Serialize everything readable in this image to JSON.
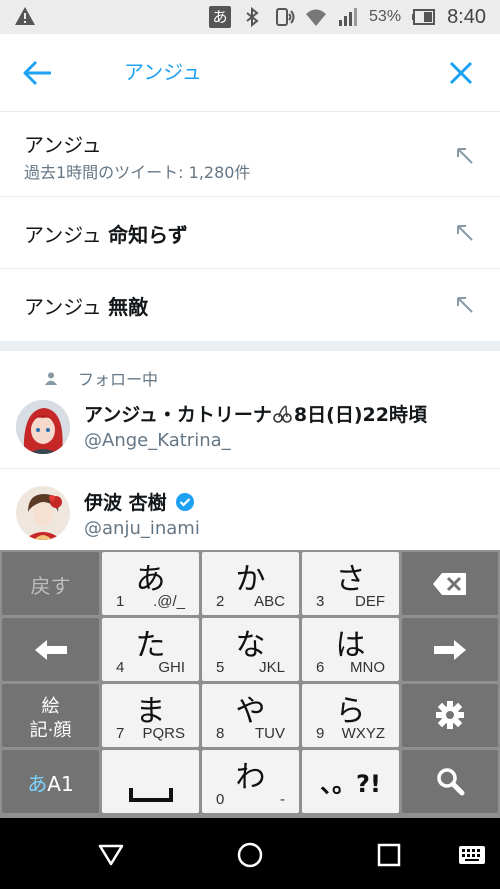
{
  "status_bar": {
    "ime_label": "あ",
    "battery": "53%",
    "time": "8:40",
    "icons": [
      "warning-icon",
      "bluetooth-icon",
      "nfc-icon",
      "wifi-icon",
      "signal-icon",
      "battery-icon"
    ]
  },
  "search": {
    "query": "アンジュ",
    "accent_color": "#1da1f2"
  },
  "suggestions": [
    {
      "main": "アンジュ",
      "bold": "",
      "sub": "過去1時間のツイート: 1,280件"
    },
    {
      "main": "アンジュ",
      "bold": "命知らず",
      "sub": ""
    },
    {
      "main": "アンジュ",
      "bold": "無敵",
      "sub": ""
    }
  ],
  "following": {
    "label": "フォロー中",
    "users": [
      {
        "name": "アンジュ・カトリーナ",
        "name_suffix": "8日(日)22時頃",
        "handle": "@Ange_Katrina_",
        "verified": false
      },
      {
        "name": "伊波 杏樹",
        "name_suffix": "",
        "handle": "@anju_inami",
        "verified": true
      }
    ]
  },
  "keyboard": {
    "left_col": [
      "戻す",
      "←",
      "絵\n記·顔",
      "あA1"
    ],
    "left_col_kana": "あ",
    "left_col_alpha": "A1",
    "emoji_line1": "絵",
    "emoji_line2": "記·顔",
    "keys": [
      {
        "main": "あ",
        "num": "1",
        "sub": ".@/_"
      },
      {
        "main": "か",
        "num": "2",
        "sub": "ABC"
      },
      {
        "main": "さ",
        "num": "3",
        "sub": "DEF"
      },
      {
        "main": "た",
        "num": "4",
        "sub": "GHI"
      },
      {
        "main": "な",
        "num": "5",
        "sub": "JKL"
      },
      {
        "main": "は",
        "num": "6",
        "sub": "MNO"
      },
      {
        "main": "ま",
        "num": "7",
        "sub": "PQRS"
      },
      {
        "main": "や",
        "num": "8",
        "sub": "TUV"
      },
      {
        "main": "ら",
        "num": "9",
        "sub": "WXYZ"
      },
      {
        "main": "わ",
        "num": "0",
        "sub": "-"
      }
    ],
    "undo_label": "戻す",
    "punct_label": "、。?!"
  }
}
